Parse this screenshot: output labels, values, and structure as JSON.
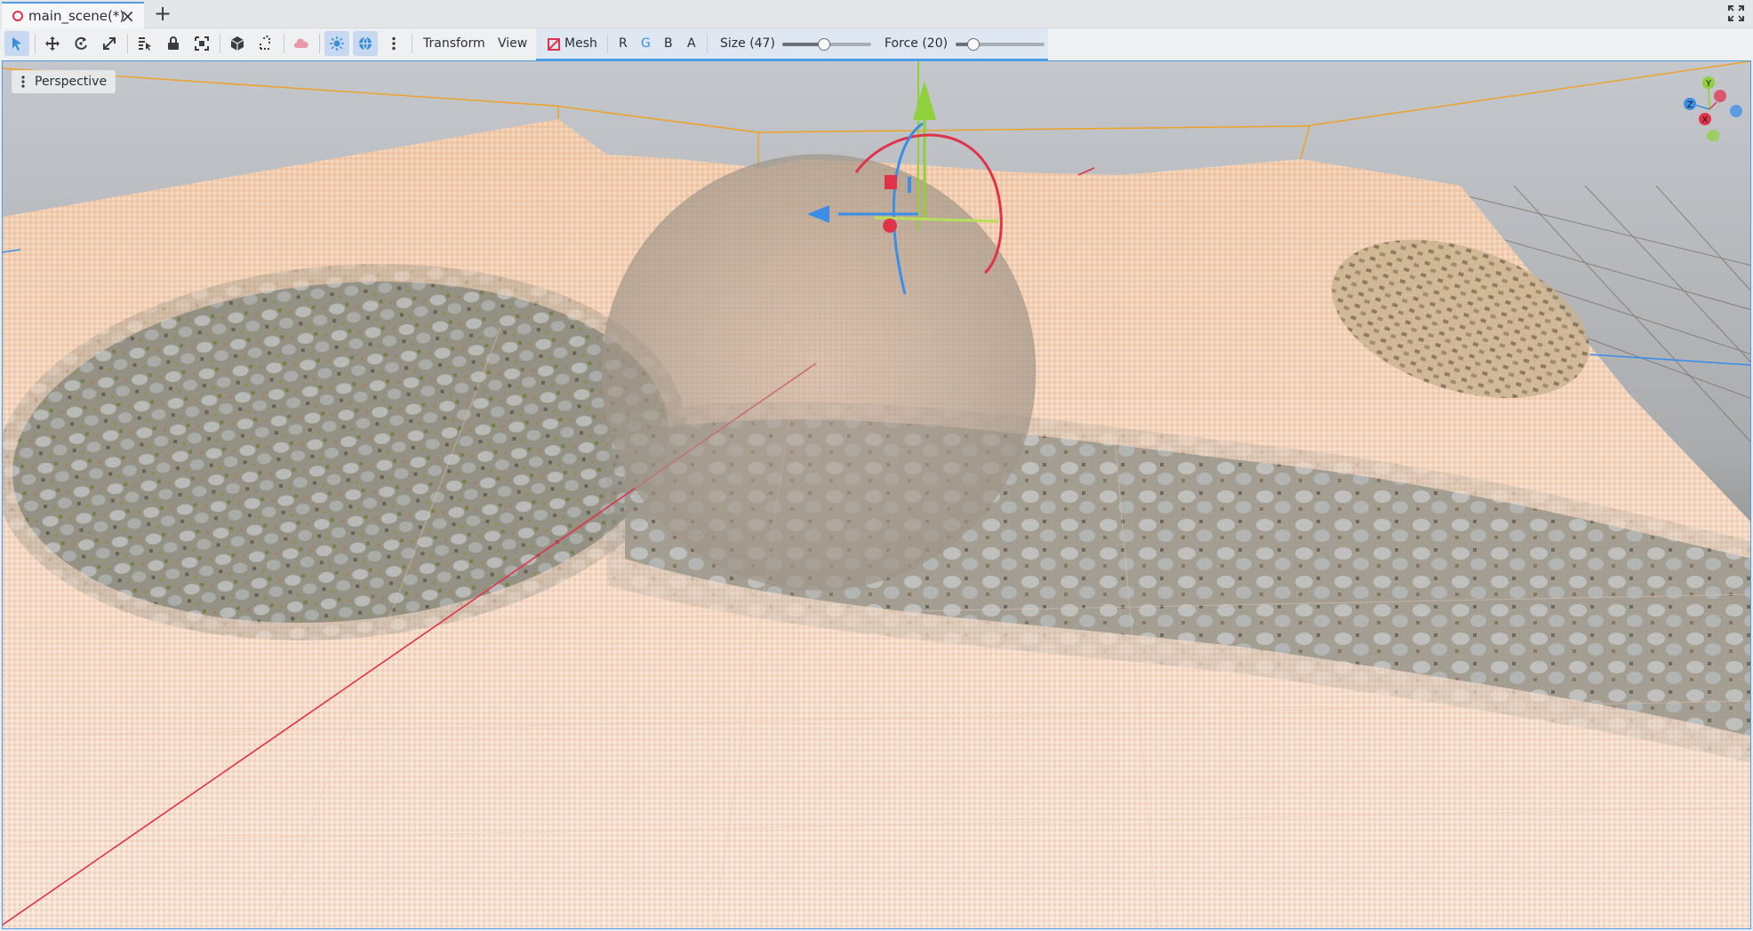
{
  "tabs": {
    "active": {
      "title": "main_scene(*)"
    },
    "add_label": "+"
  },
  "toolbar": {
    "menus": {
      "transform": "Transform",
      "view": "View"
    },
    "mesh": {
      "label": "Mesh",
      "channels": {
        "r": "R",
        "g": "G",
        "b": "B",
        "a": "A"
      },
      "active_channel": "G",
      "size_label": "Size (47)",
      "size_value": 47,
      "force_label": "Force (20)",
      "force_value": 20
    }
  },
  "viewport": {
    "mode_label": "Perspective",
    "gizmo": {
      "x": "X",
      "y": "Y",
      "z": "Z"
    }
  },
  "colors": {
    "accent": "#4d9ce8",
    "x_axis": "#e0334a",
    "y_axis": "#8fd13b",
    "z_axis": "#3b8ee8",
    "selection_box": "#f0a020"
  }
}
